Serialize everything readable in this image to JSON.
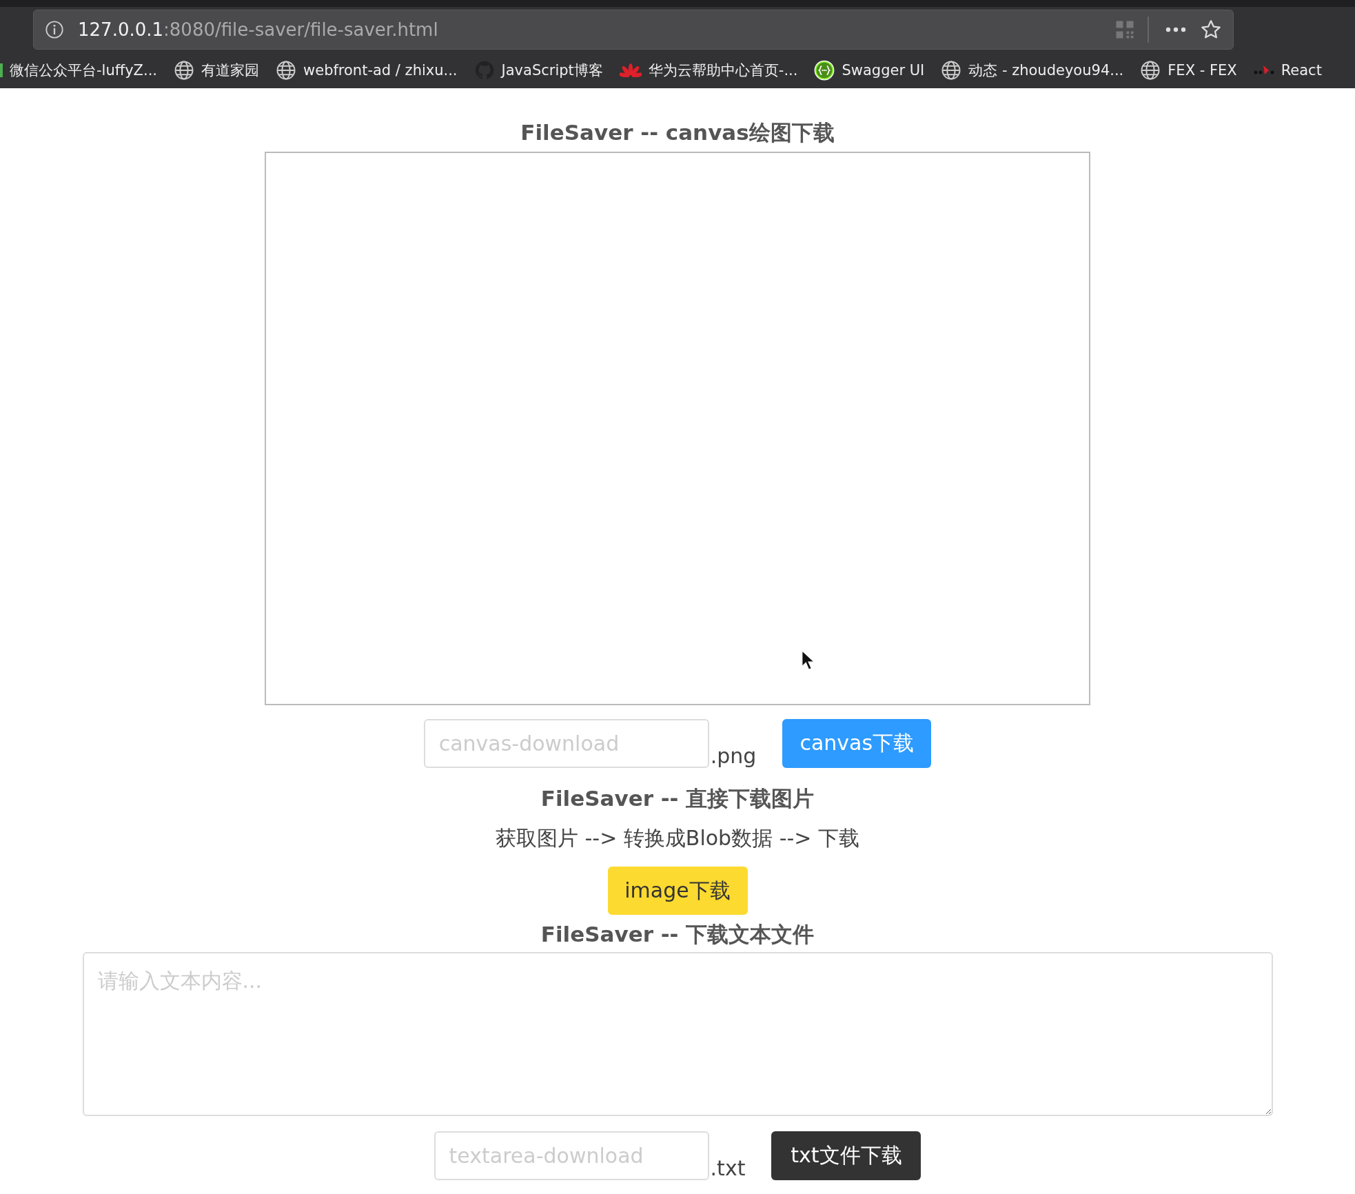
{
  "browser": {
    "url_host": "127.0.0.1",
    "url_path": ":8080/file-saver/file-saver.html",
    "bookmarks": [
      {
        "label": "微信公众平台-luffyZ...",
        "kind": "clipped"
      },
      {
        "label": "有道家园",
        "kind": "globe"
      },
      {
        "label": "webfront-ad / zhixu...",
        "kind": "globe"
      },
      {
        "label": "JavaScript博客",
        "kind": "github"
      },
      {
        "label": "华为云帮助中心首页-...",
        "kind": "flower"
      },
      {
        "label": "Swagger UI",
        "kind": "braces"
      },
      {
        "label": "动态 - zhoudeyou94...",
        "kind": "globe"
      },
      {
        "label": "FEX - FEX",
        "kind": "globe"
      },
      {
        "label": "React",
        "kind": "dots"
      }
    ]
  },
  "canvas_section": {
    "heading": "FileSaver -- canvas绘图下载",
    "filename": {
      "placeholder": "canvas-download"
    },
    "extension": ".png",
    "button": "canvas下载"
  },
  "image_section": {
    "heading": "FileSaver -- 直接下载图片",
    "description": "获取图片 --> 转换成Blob数据 --> 下载",
    "button": "image下载"
  },
  "text_section": {
    "heading": "FileSaver -- 下载文本文件",
    "textarea": {
      "placeholder": "请输入文本内容..."
    },
    "filename": {
      "placeholder": "textarea-download"
    },
    "extension": ".txt",
    "button": "txt文件下载"
  }
}
